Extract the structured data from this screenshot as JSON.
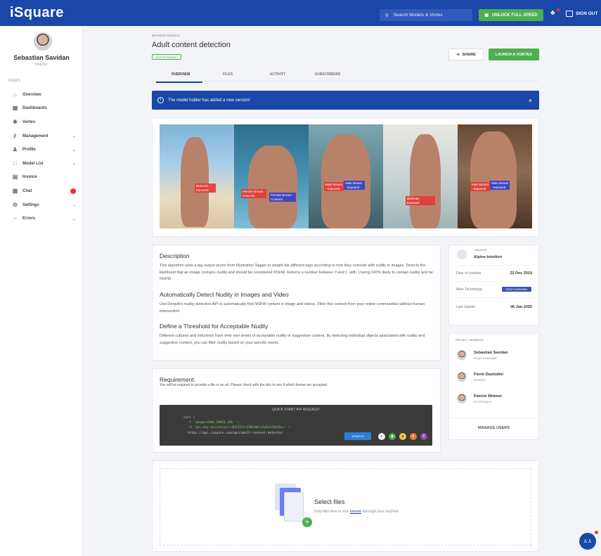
{
  "app": {
    "logo": "iSquare"
  },
  "topbar": {
    "search_label": "Search Models & Vortex",
    "unlock_label": "UNLOCK FULL SPEED",
    "signout_label": "SIGN OUT"
  },
  "user": {
    "name": "Sebastian Savidan",
    "role": "Director"
  },
  "sidebar": {
    "section_label": "PAGES",
    "items": [
      {
        "label": "Overview",
        "icon": "home-icon",
        "chevron": false,
        "badge": false
      },
      {
        "label": "Dashboards",
        "icon": "dashboard-icon",
        "chevron": false,
        "badge": false
      },
      {
        "label": "Vortex",
        "icon": "vortex-icon",
        "chevron": false,
        "badge": false
      },
      {
        "label": "Management",
        "icon": "management-icon",
        "chevron": true,
        "badge": false
      },
      {
        "label": "Profile",
        "icon": "profile-icon",
        "chevron": true,
        "badge": false
      },
      {
        "label": "Model List",
        "icon": "folder-icon",
        "chevron": true,
        "badge": false
      },
      {
        "label": "Invoice",
        "icon": "invoice-icon",
        "chevron": false,
        "badge": false
      },
      {
        "label": "Chat",
        "icon": "chat-icon",
        "chevron": false,
        "badge": true
      },
      {
        "label": "Settings",
        "icon": "gear-icon",
        "chevron": true,
        "badge": false
      },
      {
        "label": "Errors",
        "icon": "error-icon",
        "chevron": true,
        "badge": false
      }
    ]
  },
  "header": {
    "breadcrumb": "BROWSE MODELS",
    "title": "Adult content detection",
    "status_badge": "ACTIVE MODEL",
    "share_label": "SHARE",
    "launch_label": "LAUNCH A VORTEX"
  },
  "tabs": [
    {
      "label": "OVERVIEW",
      "active": true
    },
    {
      "label": "FILES",
      "active": false
    },
    {
      "label": "ACTIVITY",
      "active": false
    },
    {
      "label": "SUBSCRIBERS",
      "active": false
    }
  ],
  "alert": {
    "text": "The model holder has added a new version!",
    "close": "×"
  },
  "gallery_tags": {
    "buttocks_exposed": "Buttocks - Exposed",
    "female_breast_covered": "Female Breast - Covered",
    "male_breast_exposed": "Male Breast - Exposed"
  },
  "description": {
    "heading": "Description",
    "body": "This algorithm uses a tag output vector from Illustration Tagger to weight the different tags according to how they coincide with nudity in images. Detects the likelihood that an image contains nudity and should be considered NSFW. Returns a number between 0 and 1, with 1 being 100% likely to contain nudity and be NSFW.",
    "section2_heading": "Automatically Detect Nudity in Images and Video",
    "section2_body": "Use DeepAI's nudity detection API to automatically find NSFW content in image and videos. Filter this content from your online communities without human intervention.",
    "section3_heading": "Define a Threshold for Acceptable Nudity",
    "section3_body": "Different cultures and industries have their own levels of acceptable nudity or suggestive content. By detecting individual objects associated with nudity and suggestive content, you can filter nudity based on your specific needs."
  },
  "creator": {
    "label": "CREATOR",
    "name": "Alpine Intuition",
    "date_created_label": "Date of creation",
    "date_created": "22 Dec 2019",
    "technology_label": "Main Technology",
    "technology": "DEEP LEARNING",
    "last_update_label": "Last Update",
    "last_update": "06 Jan 2020"
  },
  "members": {
    "label": "PROJECT MEMBERS",
    "items": [
      {
        "name": "Sebastian Savidan",
        "role": "Project Manager"
      },
      {
        "name": "Florin Dastodini",
        "role": "DevOps"
      },
      {
        "name": "Patrick Widmer",
        "role": "UX Designer"
      }
    ],
    "manage_label": "MANAGE USERS"
  },
  "requirement": {
    "heading": "Requirement:",
    "body": "You will be required to provide a file or an url. Please check with the doc to see if which format are accepted."
  },
  "code": {
    "title": "QUICK START API REQUEST",
    "line1": "curl \\",
    "line2": "-F 'image=YOUR_IMAGE_URL' \\",
    "line3": "-H 'api-key:quickstart-QUdJIGlzIGNvbWluZyBzb29uIQ==' \\",
    "line4": "https://api.isquare.com/api/adult-content-detector",
    "button": "APIKEYS"
  },
  "upload": {
    "title": "Select files",
    "hint_prefix": "Drop files here or click ",
    "hint_link": "browse",
    "hint_suffix": " thorough your machine"
  },
  "colors": {
    "brand": "#1a47a8",
    "success": "#4caf50",
    "danger": "#e53935",
    "accent": "#3f51b5"
  }
}
